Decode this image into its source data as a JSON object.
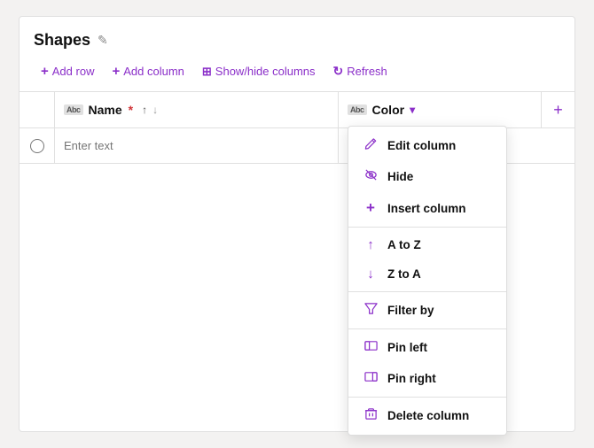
{
  "panel": {
    "title": "Shapes",
    "edit_icon": "✎"
  },
  "toolbar": {
    "add_row": "Add row",
    "add_column": "Add column",
    "show_hide": "Show/hide columns",
    "refresh": "Refresh"
  },
  "grid": {
    "name_column": "Name",
    "required_star": "*",
    "color_column": "Color",
    "add_col_label": "+",
    "type_icon": "Abc",
    "enter_text_placeholder": "Enter text"
  },
  "dropdown": {
    "items": [
      {
        "id": "edit-column",
        "label": "Edit column",
        "icon": "pencil"
      },
      {
        "id": "hide",
        "label": "Hide",
        "icon": "eye-off"
      },
      {
        "id": "insert-column",
        "label": "Insert column",
        "icon": "plus"
      },
      {
        "id": "a-to-z",
        "label": "A to Z",
        "icon": "arrow-up"
      },
      {
        "id": "z-to-a",
        "label": "Z to A",
        "icon": "arrow-down"
      },
      {
        "id": "filter-by",
        "label": "Filter by",
        "icon": "filter"
      },
      {
        "id": "pin-left",
        "label": "Pin left",
        "icon": "pin-left"
      },
      {
        "id": "pin-right",
        "label": "Pin right",
        "icon": "pin-right"
      },
      {
        "id": "delete-column",
        "label": "Delete column",
        "icon": "trash"
      }
    ]
  }
}
